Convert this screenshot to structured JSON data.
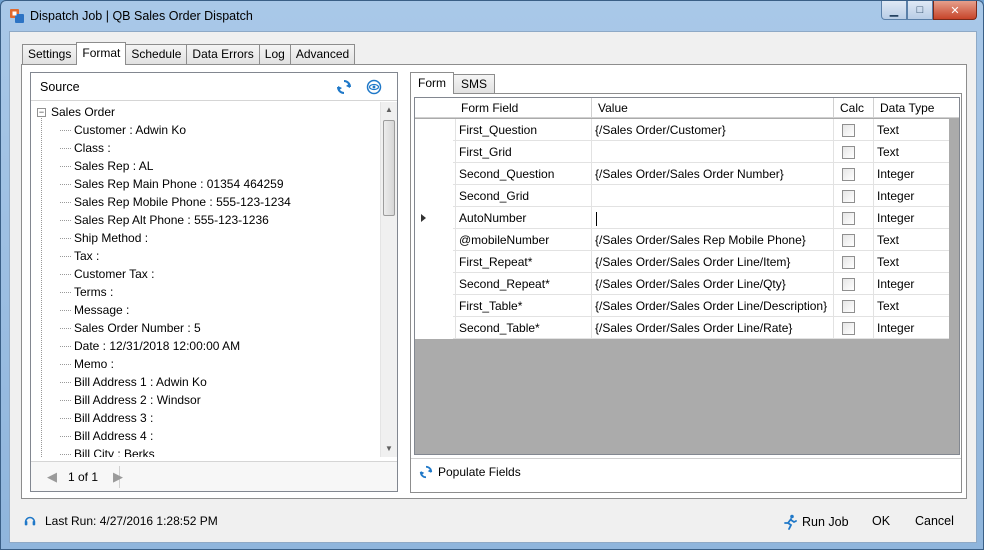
{
  "window": {
    "title": "Dispatch Job | QB Sales Order Dispatch",
    "minimize_glyph": "▁",
    "maximize_glyph": "□",
    "close_glyph": "✕"
  },
  "main_tabs": [
    "Settings",
    "Format",
    "Schedule",
    "Data Errors",
    "Log",
    "Advanced"
  ],
  "source": {
    "title": "Source",
    "refresh_icon": "refresh-icon",
    "view_icon": "eye-icon",
    "root": "Sales Order",
    "expander": "−",
    "items": [
      "Customer : Adwin Ko",
      "Class :",
      "Sales Rep : AL",
      "Sales Rep Main Phone : 01354 464259",
      "Sales Rep Mobile Phone : 555-123-1234",
      "Sales Rep Alt Phone : 555-123-1236",
      "Ship Method :",
      "Tax :",
      "Customer Tax :",
      "Terms :",
      "Message :",
      "Sales Order Number : 5",
      "Date : 12/31/2018 12:00:00 AM",
      "Memo :",
      "Bill Address 1 : Adwin Ko",
      "Bill Address 2 : Windsor",
      "Bill Address 3 :",
      "Bill Address 4 :",
      "Bill City : Berks"
    ],
    "pager": {
      "text": "1 of 1",
      "prev": "◀",
      "next": "▶"
    }
  },
  "inner_tabs": [
    "Form",
    "SMS"
  ],
  "grid": {
    "columns": [
      "Form Field",
      "Value",
      "Calc",
      "Data Type"
    ],
    "rows": [
      {
        "field": "First_Question",
        "value": "{/Sales Order/Customer}",
        "type": "Text"
      },
      {
        "field": "First_Grid",
        "value": "",
        "type": "Text"
      },
      {
        "field": "Second_Question",
        "value": "{/Sales Order/Sales Order Number}",
        "type": "Integer"
      },
      {
        "field": "Second_Grid",
        "value": "",
        "type": "Integer"
      },
      {
        "field": "AutoNumber",
        "value": "",
        "type": "Integer"
      },
      {
        "field": "@mobileNumber",
        "value": "{/Sales Order/Sales Rep Mobile Phone}",
        "type": "Text"
      },
      {
        "field": "First_Repeat*",
        "value": "{/Sales Order/Sales Order Line/Item}",
        "type": "Text"
      },
      {
        "field": "Second_Repeat*",
        "value": "{/Sales Order/Sales Order Line/Qty}",
        "type": "Integer"
      },
      {
        "field": "First_Table*",
        "value": "{/Sales Order/Sales Order Line/Description}",
        "type": "Text"
      },
      {
        "field": "Second_Table*",
        "value": "{/Sales Order/Sales Order Line/Rate}",
        "type": "Integer"
      }
    ]
  },
  "populate_label": "Populate Fields",
  "footer": {
    "last_run": "Last Run: 4/27/2016 1:28:52 PM",
    "run_job": "Run Job",
    "ok": "OK",
    "cancel": "Cancel"
  },
  "colors": {
    "accent": "#1f78c8",
    "title_gradient_top": "#a9c8e8",
    "close": "#c7442a"
  }
}
